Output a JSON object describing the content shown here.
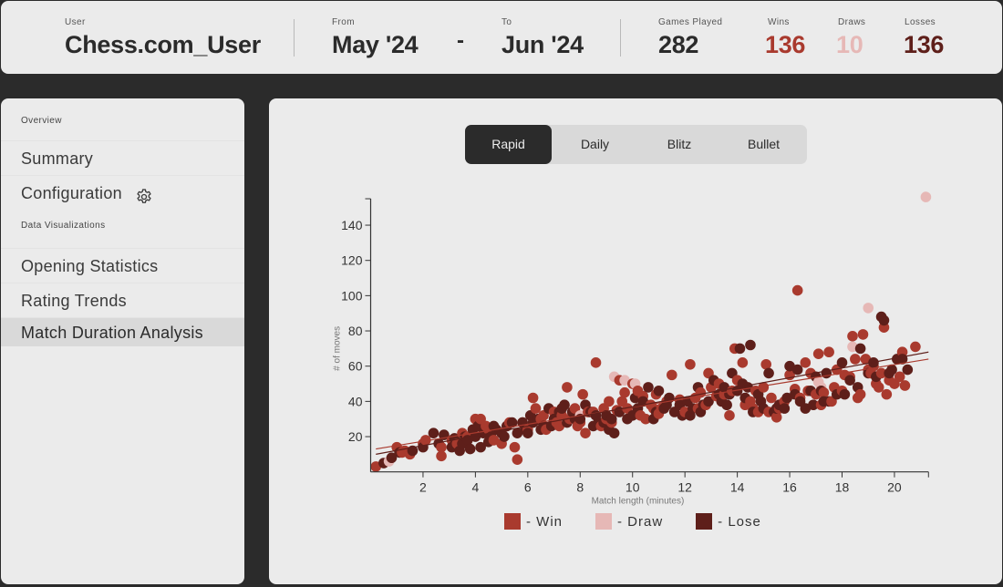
{
  "header": {
    "user_label": "User",
    "user_value": "Chess.com_User",
    "from_label": "From",
    "from_value": "May '24",
    "range_separator": "-",
    "to_label": "To",
    "to_value": "Jun '24",
    "games_played_label": "Games Played",
    "games_played_value": "282",
    "wins_label": "Wins",
    "wins_value": "136",
    "draws_label": "Draws",
    "draws_value": "10",
    "losses_label": "Losses",
    "losses_value": "136"
  },
  "colors": {
    "win": "#a93a2e",
    "draw": "#e6b8b6",
    "lose": "#5e1f1a",
    "dark": "#2b2b2b",
    "panel": "#ebebeb"
  },
  "sidebar": {
    "sections": [
      {
        "title": "Overview",
        "items": [
          {
            "label": "Summary",
            "icon": null,
            "active": false
          },
          {
            "label": "Configuration",
            "icon": "gear-icon",
            "active": false
          }
        ]
      },
      {
        "title": "Data Visualizations",
        "items": [
          {
            "label": "Opening Statistics",
            "active": false
          },
          {
            "label": "Rating Trends",
            "active": false
          },
          {
            "label": "Match Duration Analysis",
            "active": true
          }
        ]
      }
    ]
  },
  "tabs": [
    {
      "label": "Rapid",
      "active": true
    },
    {
      "label": "Daily",
      "active": false
    },
    {
      "label": "Blitz",
      "active": false
    },
    {
      "label": "Bullet",
      "active": false
    }
  ],
  "chart_data": {
    "type": "scatter",
    "title": "",
    "xlabel": "Match length (minutes)",
    "ylabel": "# of moves",
    "xlim": [
      0,
      21.3
    ],
    "ylim": [
      0,
      155
    ],
    "xticks": [
      2,
      4,
      6,
      8,
      10,
      12,
      14,
      16,
      18,
      20
    ],
    "yticks": [
      20,
      40,
      60,
      80,
      100,
      120,
      140
    ],
    "grid": false,
    "legend": {
      "placement": "bottom",
      "entries": [
        {
          "label": "- Win",
          "series": "Win"
        },
        {
          "label": "- Draw",
          "series": "Draw"
        },
        {
          "label": "- Lose",
          "series": "Lose"
        }
      ]
    },
    "trendlines": [
      {
        "series": "Win",
        "from": [
          0.2,
          13
        ],
        "to": [
          21.3,
          64
        ]
      },
      {
        "series": "Lose",
        "from": [
          0.2,
          10
        ],
        "to": [
          21.3,
          68
        ]
      }
    ],
    "series": [
      {
        "name": "Win",
        "points": [
          [
            0.2,
            3
          ],
          [
            1.0,
            14
          ],
          [
            1.2,
            11
          ],
          [
            1.5,
            10
          ],
          [
            2.0,
            16
          ],
          [
            2.7,
            14
          ],
          [
            2.7,
            9
          ],
          [
            3.5,
            22
          ],
          [
            3.7,
            20
          ],
          [
            4.0,
            30
          ],
          [
            4.2,
            30
          ],
          [
            4.5,
            24
          ],
          [
            4.7,
            18
          ],
          [
            5.0,
            16
          ],
          [
            5.2,
            26
          ],
          [
            5.5,
            14
          ],
          [
            5.6,
            7
          ],
          [
            5.8,
            28
          ],
          [
            6.0,
            24
          ],
          [
            6.2,
            42
          ],
          [
            6.5,
            30
          ],
          [
            6.7,
            24
          ],
          [
            7.0,
            34
          ],
          [
            7.1,
            28
          ],
          [
            7.3,
            32
          ],
          [
            7.5,
            48
          ],
          [
            7.6,
            30
          ],
          [
            7.8,
            36
          ],
          [
            8.0,
            28
          ],
          [
            8.1,
            44
          ],
          [
            8.2,
            22
          ],
          [
            8.5,
            34
          ],
          [
            8.6,
            62
          ],
          [
            8.8,
            26
          ],
          [
            9.0,
            30
          ],
          [
            9.2,
            28
          ],
          [
            9.4,
            35
          ],
          [
            9.6,
            40
          ],
          [
            9.7,
            45
          ],
          [
            9.8,
            36
          ],
          [
            10.0,
            50
          ],
          [
            10.2,
            46
          ],
          [
            10.4,
            43
          ],
          [
            10.5,
            30
          ],
          [
            10.7,
            38
          ],
          [
            10.8,
            36
          ],
          [
            11.0,
            33
          ],
          [
            11.3,
            40
          ],
          [
            11.5,
            55
          ],
          [
            11.8,
            41
          ],
          [
            12.0,
            34
          ],
          [
            12.2,
            61
          ],
          [
            12.5,
            36
          ],
          [
            12.6,
            45
          ],
          [
            12.8,
            38
          ],
          [
            13.0,
            48
          ],
          [
            13.2,
            43
          ],
          [
            13.4,
            40
          ],
          [
            13.5,
            44
          ],
          [
            13.7,
            32
          ],
          [
            13.8,
            46
          ],
          [
            14.0,
            52
          ],
          [
            14.2,
            62
          ],
          [
            14.3,
            38
          ],
          [
            14.5,
            40
          ],
          [
            14.7,
            46
          ],
          [
            14.8,
            34
          ],
          [
            15.0,
            48
          ],
          [
            15.1,
            61
          ],
          [
            15.3,
            42
          ],
          [
            15.5,
            31
          ],
          [
            15.6,
            36
          ],
          [
            15.8,
            40
          ],
          [
            16.0,
            55
          ],
          [
            16.2,
            47
          ],
          [
            16.3,
            103
          ],
          [
            16.4,
            42
          ],
          [
            16.6,
            62
          ],
          [
            16.7,
            46
          ],
          [
            17.0,
            44
          ],
          [
            17.1,
            67
          ],
          [
            17.2,
            38
          ],
          [
            17.3,
            45
          ],
          [
            17.5,
            68
          ],
          [
            17.6,
            40
          ],
          [
            17.8,
            58
          ],
          [
            18.0,
            46
          ],
          [
            18.1,
            55
          ],
          [
            18.4,
            77
          ],
          [
            18.5,
            64
          ],
          [
            18.6,
            42
          ],
          [
            18.7,
            44
          ],
          [
            18.8,
            78
          ],
          [
            18.9,
            64
          ],
          [
            19.1,
            56
          ],
          [
            19.2,
            60
          ],
          [
            19.3,
            50
          ],
          [
            19.4,
            48
          ],
          [
            19.5,
            56
          ],
          [
            19.6,
            82
          ],
          [
            19.7,
            44
          ],
          [
            19.8,
            52
          ],
          [
            20.0,
            50
          ],
          [
            20.2,
            54
          ],
          [
            20.3,
            68
          ],
          [
            20.4,
            49
          ],
          [
            20.8,
            71
          ],
          [
            1.3,
            12
          ],
          [
            2.1,
            18
          ],
          [
            3.3,
            16
          ],
          [
            4.4,
            26
          ],
          [
            6.3,
            36
          ],
          [
            7.2,
            26
          ],
          [
            8.3,
            34
          ],
          [
            9.1,
            40
          ],
          [
            10.3,
            32
          ],
          [
            11.1,
            36
          ],
          [
            12.4,
            42
          ],
          [
            13.3,
            50
          ],
          [
            14.6,
            36
          ],
          [
            15.2,
            34
          ],
          [
            16.8,
            56
          ],
          [
            17.7,
            48
          ],
          [
            18.3,
            54
          ],
          [
            19.0,
            58
          ],
          [
            10.9,
            44
          ],
          [
            12.9,
            56
          ],
          [
            13.9,
            70
          ],
          [
            9.5,
            52
          ],
          [
            5.3,
            28
          ],
          [
            6.6,
            32
          ],
          [
            7.9,
            26
          ],
          [
            4.1,
            28
          ],
          [
            3.1,
            18
          ],
          [
            8.9,
            36
          ]
        ]
      },
      {
        "name": "Draw",
        "points": [
          [
            0.7,
            6
          ],
          [
            9.3,
            54
          ],
          [
            9.7,
            52
          ],
          [
            10.1,
            50
          ],
          [
            17.1,
            51
          ],
          [
            17.2,
            48
          ],
          [
            18.4,
            71
          ],
          [
            19.0,
            93
          ],
          [
            21.2,
            156
          ],
          [
            8.0,
            32
          ]
        ]
      },
      {
        "name": "Lose",
        "points": [
          [
            0.5,
            5
          ],
          [
            0.8,
            8
          ],
          [
            1.1,
            11
          ],
          [
            1.6,
            12
          ],
          [
            2.0,
            14
          ],
          [
            2.4,
            22
          ],
          [
            2.8,
            21
          ],
          [
            3.1,
            14
          ],
          [
            3.2,
            19
          ],
          [
            3.4,
            12
          ],
          [
            3.5,
            16
          ],
          [
            3.7,
            18
          ],
          [
            3.8,
            13
          ],
          [
            4.0,
            20
          ],
          [
            4.1,
            26
          ],
          [
            4.2,
            14
          ],
          [
            4.3,
            22
          ],
          [
            4.5,
            17
          ],
          [
            4.7,
            26
          ],
          [
            5.0,
            22
          ],
          [
            5.2,
            26
          ],
          [
            5.4,
            28
          ],
          [
            5.6,
            22
          ],
          [
            5.8,
            28
          ],
          [
            6.0,
            22
          ],
          [
            6.2,
            28
          ],
          [
            6.4,
            30
          ],
          [
            6.6,
            26
          ],
          [
            6.8,
            36
          ],
          [
            7.0,
            30
          ],
          [
            7.2,
            34
          ],
          [
            7.4,
            38
          ],
          [
            7.7,
            34
          ],
          [
            8.0,
            30
          ],
          [
            8.2,
            38
          ],
          [
            8.4,
            34
          ],
          [
            8.6,
            32
          ],
          [
            8.7,
            28
          ],
          [
            9.0,
            32
          ],
          [
            9.1,
            24
          ],
          [
            9.3,
            22
          ],
          [
            9.5,
            34
          ],
          [
            9.8,
            30
          ],
          [
            10.0,
            32
          ],
          [
            10.2,
            36
          ],
          [
            10.4,
            40
          ],
          [
            10.6,
            48
          ],
          [
            10.8,
            30
          ],
          [
            11.0,
            46
          ],
          [
            11.2,
            36
          ],
          [
            11.4,
            42
          ],
          [
            11.6,
            34
          ],
          [
            11.8,
            38
          ],
          [
            12.1,
            40
          ],
          [
            12.3,
            36
          ],
          [
            12.5,
            48
          ],
          [
            12.7,
            38
          ],
          [
            12.9,
            40
          ],
          [
            13.1,
            52
          ],
          [
            13.3,
            44
          ],
          [
            13.5,
            48
          ],
          [
            13.6,
            38
          ],
          [
            13.8,
            56
          ],
          [
            14.0,
            46
          ],
          [
            14.1,
            70
          ],
          [
            14.2,
            50
          ],
          [
            14.4,
            48
          ],
          [
            14.5,
            72
          ],
          [
            14.6,
            34
          ],
          [
            14.8,
            44
          ],
          [
            15.0,
            36
          ],
          [
            15.2,
            56
          ],
          [
            15.4,
            34
          ],
          [
            15.6,
            38
          ],
          [
            15.8,
            36
          ],
          [
            16.0,
            60
          ],
          [
            16.2,
            44
          ],
          [
            16.4,
            40
          ],
          [
            16.6,
            36
          ],
          [
            16.8,
            46
          ],
          [
            17.0,
            54
          ],
          [
            17.2,
            46
          ],
          [
            17.3,
            40
          ],
          [
            17.5,
            40
          ],
          [
            17.8,
            44
          ],
          [
            18.0,
            62
          ],
          [
            18.3,
            52
          ],
          [
            18.6,
            48
          ],
          [
            18.7,
            70
          ],
          [
            19.0,
            56
          ],
          [
            19.3,
            54
          ],
          [
            19.5,
            88
          ],
          [
            19.6,
            86
          ],
          [
            19.8,
            56
          ],
          [
            19.9,
            58
          ],
          [
            20.1,
            64
          ],
          [
            20.3,
            64
          ],
          [
            5.1,
            20
          ],
          [
            5.9,
            24
          ],
          [
            6.5,
            24
          ],
          [
            7.5,
            28
          ],
          [
            8.5,
            26
          ],
          [
            9.2,
            30
          ],
          [
            10.9,
            34
          ],
          [
            11.9,
            32
          ],
          [
            12.6,
            34
          ],
          [
            13.4,
            40
          ],
          [
            14.3,
            42
          ],
          [
            15.5,
            36
          ],
          [
            16.3,
            58
          ],
          [
            17.4,
            56
          ],
          [
            18.1,
            44
          ],
          [
            19.2,
            62
          ],
          [
            20.5,
            58
          ],
          [
            4.6,
            20
          ],
          [
            3.9,
            24
          ],
          [
            2.6,
            16
          ],
          [
            6.9,
            26
          ],
          [
            7.8,
            30
          ],
          [
            8.9,
            28
          ],
          [
            10.1,
            42
          ],
          [
            11.3,
            38
          ],
          [
            12.2,
            32
          ],
          [
            13.7,
            44
          ],
          [
            14.9,
            40
          ],
          [
            15.9,
            42
          ],
          [
            16.9,
            38
          ],
          [
            3.6,
            20
          ],
          [
            4.8,
            24
          ],
          [
            6.1,
            32
          ],
          [
            7.3,
            36
          ]
        ]
      }
    ]
  }
}
